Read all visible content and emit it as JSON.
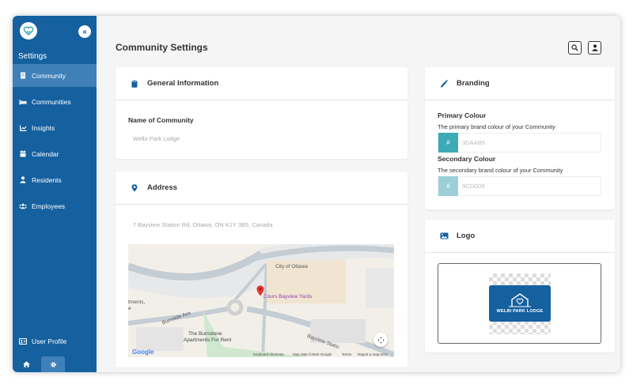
{
  "sidebar": {
    "heading": "Settings",
    "items": [
      {
        "label": "Community",
        "icon": "building-icon",
        "active": true
      },
      {
        "label": "Communities",
        "icon": "bed-icon"
      },
      {
        "label": "Insights",
        "icon": "chart-icon"
      },
      {
        "label": "Calendar",
        "icon": "calendar-icon"
      },
      {
        "label": "Residents",
        "icon": "user-icon"
      },
      {
        "label": "Employees",
        "icon": "users-icon"
      }
    ],
    "bottom_item": {
      "label": "User Profile",
      "icon": "id-card-icon"
    }
  },
  "header": {
    "title": "Community Settings"
  },
  "general": {
    "title": "General Information",
    "name_label": "Name of Community",
    "name_value": "Welbi Park Lodge"
  },
  "address": {
    "title": "Address",
    "value": "7 Bayview Station Rd, Ottawa, ON K1Y 3B5, Canada",
    "map": {
      "labels": {
        "city": "City of Ottawa",
        "place": "Cours Bayview Yards",
        "building1": "The Burnstone",
        "building2": "Apartments For Rent",
        "road1": "Burnside Ave",
        "road2": "Bayview Statio",
        "edge": "tments,",
        "edge2": "e"
      },
      "google": "Google",
      "footer": {
        "shortcuts": "Keyboard shortcuts",
        "mapdata": "Map data ©2025 Google",
        "terms": "Terms",
        "report": "Report a map error"
      }
    }
  },
  "branding": {
    "title": "Branding",
    "primary_label": "Primary Colour",
    "primary_desc": "The primary brand colour of your Community",
    "primary_hex": "3DAAB5",
    "secondary_label": "Secondary Colour",
    "secondary_desc": "The secondary brand colour of your Community",
    "secondary_hex": "9CD0D9",
    "hash": "#",
    "colors": {
      "primary": "#3DAAB5",
      "secondary": "#9CD0D9",
      "sidebar": "#15609f"
    }
  },
  "logo": {
    "title": "Logo",
    "brand_text": "WELBI PARK LODGE"
  }
}
